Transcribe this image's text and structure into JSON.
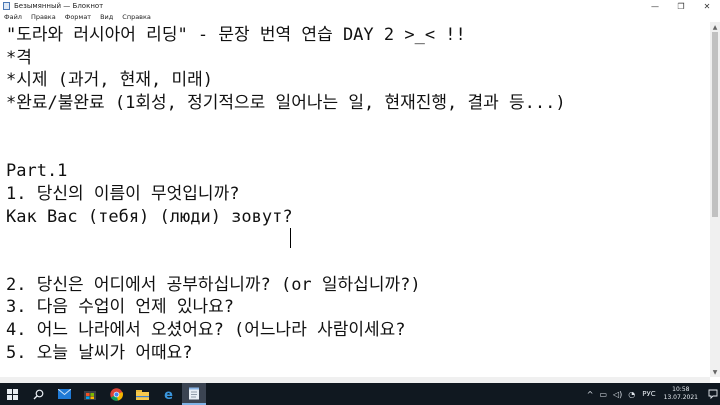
{
  "window": {
    "title": "Безымянный — Блокнот",
    "controls": {
      "minimize": "—",
      "maximize": "❐",
      "close": "✕"
    }
  },
  "menu": {
    "items": [
      {
        "label": "Файл"
      },
      {
        "label": "Правка"
      },
      {
        "label": "Формат"
      },
      {
        "label": "Вид"
      },
      {
        "label": "Справка"
      }
    ]
  },
  "editor": {
    "lines": [
      "\"도라와 러시아어 리딩\" - 문장 번역 연습 DAY 2 >_< !!",
      "*격",
      "*시제 (과거, 현재, 미래)",
      "*완료/불완료 (1회성, 정기적으로 일어나는 일, 현재진행, 결과 등...)",
      "",
      "",
      "Part.1",
      "1. 당신의 이름이 무엇입니까?",
      "Как Вас (тебя) (люди) зовут?",
      "",
      "",
      "2. 당신은 어디에서 공부하십니까? (or 일하십니까?)",
      "3. 다음 수업이 언제 있나요?",
      "4. 어느 나라에서 오셨어요? (어느나라 사람이세요?",
      "5. 오늘 날씨가 어때요?"
    ]
  },
  "taskbar": {
    "icons": [
      "windows-start-icon",
      "search-icon",
      "mail-icon",
      "store-icon",
      "chrome-icon",
      "file-explorer-icon",
      "edge-icon",
      "notepad-icon"
    ],
    "tray": {
      "language": "РУС",
      "time": "10:58",
      "date": "13.07.2021"
    }
  }
}
